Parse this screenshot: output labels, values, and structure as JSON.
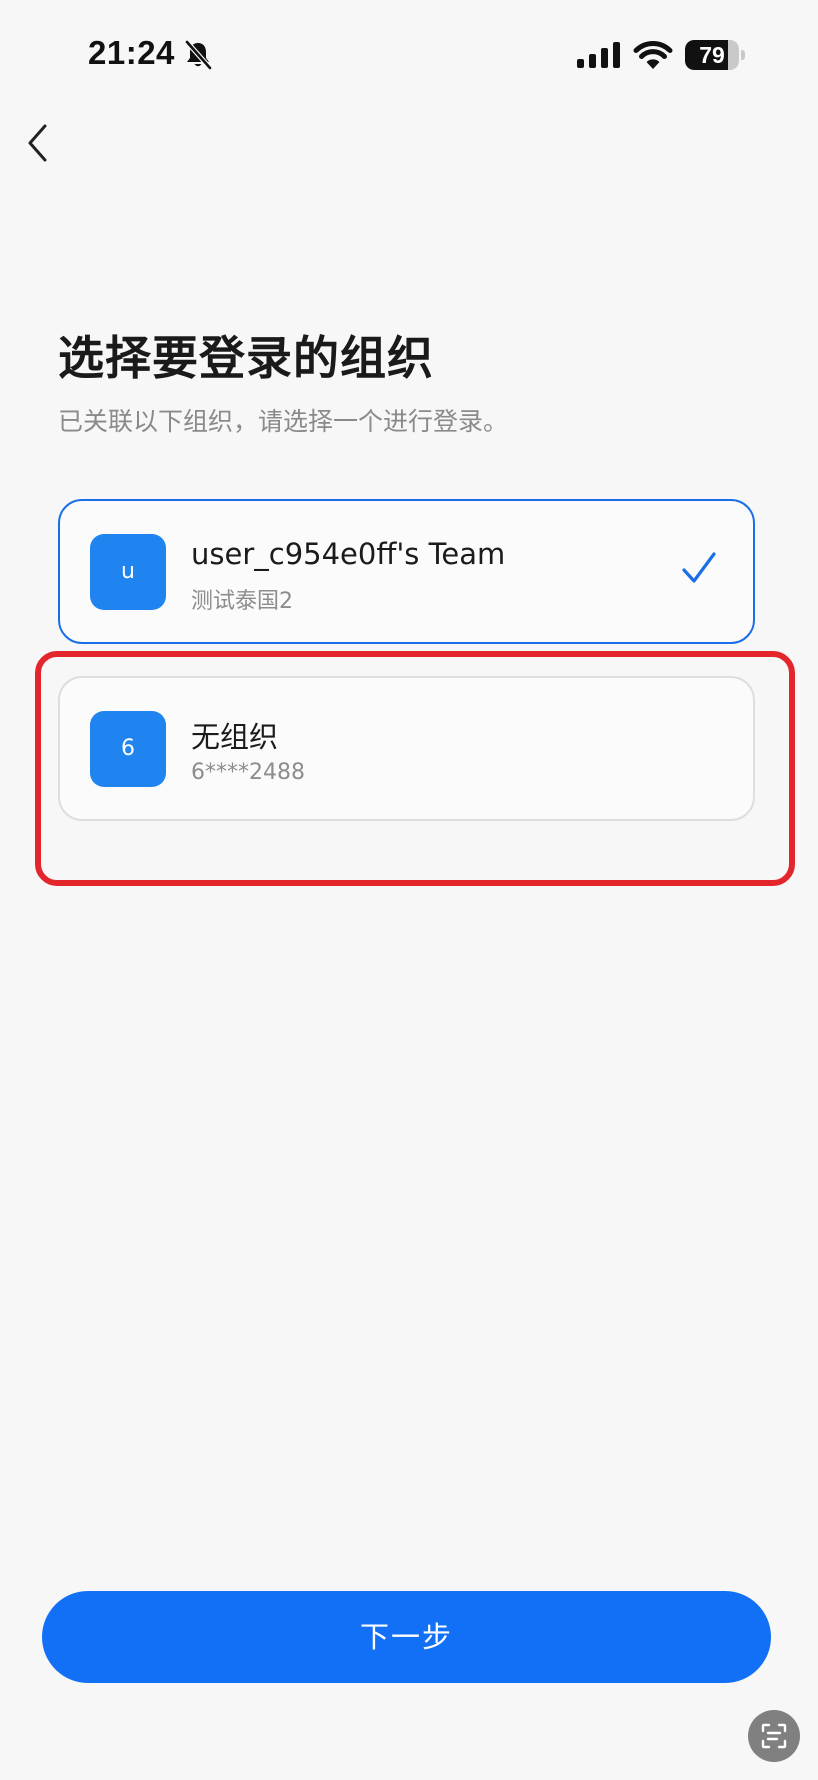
{
  "status_bar": {
    "time": "21:24",
    "battery_level": "79",
    "battery_fraction": 0.79,
    "icons": [
      "bell-muted-icon",
      "cellular-signal-icon",
      "wifi-icon",
      "battery-icon"
    ]
  },
  "nav": {
    "back_icon": "chevron-left-icon"
  },
  "header": {
    "title": "选择要登录的组织",
    "subtitle": "已关联以下组织，请选择一个进行登录。"
  },
  "organizations": [
    {
      "avatar_letter": "u",
      "name": "user_c954e0ff's Team",
      "subtitle": "测试泰国2",
      "selected": true,
      "selected_icon": "checkmark-icon"
    },
    {
      "avatar_letter": "6",
      "name": "无组织",
      "subtitle": "6****2488",
      "selected": false
    }
  ],
  "actions": {
    "next_label": "下一步"
  },
  "floating": {
    "scan_icon": "scan-text-icon"
  },
  "colors": {
    "accent": "#1170f6",
    "avatar": "#1f83f0",
    "selected_border": "#1a6fe8",
    "highlight_annotation": "#e3262c",
    "background": "#f7f7f7"
  }
}
